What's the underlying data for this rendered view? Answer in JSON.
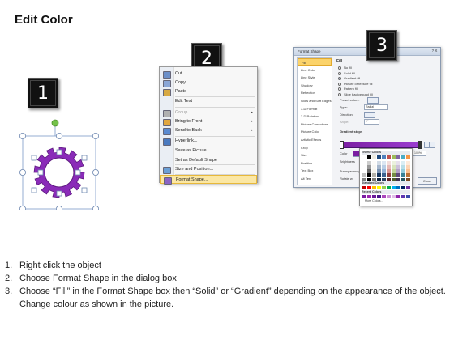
{
  "header": {
    "title": "Edit Color"
  },
  "badges": [
    "1",
    "2",
    "3"
  ],
  "context_menu": {
    "items": [
      {
        "label": "Cut",
        "icon": "scissors-icon",
        "enabled": true,
        "submenu": false
      },
      {
        "label": "Copy",
        "icon": "copy-icon",
        "enabled": true,
        "submenu": false
      },
      {
        "label": "Paste",
        "icon": "paste-icon",
        "enabled": true,
        "submenu": false
      },
      {
        "label": "Edit Text",
        "icon": "",
        "enabled": true,
        "submenu": false
      },
      {
        "label": "Group",
        "icon": "group-icon",
        "enabled": false,
        "submenu": true
      },
      {
        "label": "Bring to Front",
        "icon": "bring-to-front-icon",
        "enabled": true,
        "submenu": true
      },
      {
        "label": "Send to Back",
        "icon": "send-to-back-icon",
        "enabled": true,
        "submenu": true
      },
      {
        "label": "Hyperlink...",
        "icon": "hyperlink-icon",
        "enabled": true,
        "submenu": false
      },
      {
        "label": "Save as Picture...",
        "icon": "",
        "enabled": true,
        "submenu": false
      },
      {
        "label": "Set as Default Shape",
        "icon": "",
        "enabled": true,
        "submenu": false
      },
      {
        "label": "Size and Position...",
        "icon": "size-icon",
        "enabled": true,
        "submenu": false
      },
      {
        "label": "Format Shape...",
        "icon": "format-shape-icon",
        "enabled": true,
        "submenu": false,
        "selected": true
      }
    ]
  },
  "dialog": {
    "title": "Format Shape",
    "close": "?  X",
    "sidebar": [
      "Fill",
      "Line Color",
      "Line Style",
      "Shadow",
      "Reflection",
      "Glow and Soft Edges",
      "3-D Format",
      "3-D Rotation",
      "Picture Corrections",
      "Picture Color",
      "Artistic Effects",
      "Crop",
      "Size",
      "Position",
      "Text Box",
      "Alt Text"
    ],
    "fill_heading": "Fill",
    "fill_options": [
      {
        "label": "No fill",
        "on": false
      },
      {
        "label": "Solid fill",
        "on": false
      },
      {
        "label": "Gradient fill",
        "on": true
      },
      {
        "label": "Picture or texture fill",
        "on": false
      },
      {
        "label": "Pattern fill",
        "on": false
      },
      {
        "label": "Slide background fill",
        "on": false
      }
    ],
    "preset_label": "Preset colors:",
    "type_label": "Type:",
    "type_value": "Radial",
    "direction_label": "Direction:",
    "angle_label": "Angle:",
    "angle_value": "0°",
    "stops_label": "Gradient stops",
    "color_label": "Color",
    "position_label": "Position:",
    "position_value": "100%",
    "brightness_label": "Brightness",
    "transparency_label": "Transparency",
    "rotate_label": "Rotate w",
    "close_button": "Close"
  },
  "palette": {
    "theme_label": "Theme Colors",
    "standard_label": "Standard Colors",
    "recent_label": "Recent Colors",
    "more_label": "More Colors...",
    "theme_top": [
      "#ffffff",
      "#000000",
      "#eeece1",
      "#1f497d",
      "#4f81bd",
      "#c0504d",
      "#9bbb59",
      "#8064a2",
      "#4bacc6",
      "#f79646"
    ],
    "standard": [
      "#c00000",
      "#ff0000",
      "#ffc000",
      "#ffff00",
      "#92d050",
      "#00b050",
      "#00b0f0",
      "#0070c0",
      "#002060",
      "#7030a0"
    ],
    "recent": [
      "#7b1fa2",
      "#9c27b0",
      "#6a1b9a",
      "#4a148c",
      "#ab47bc",
      "#ce93d8",
      "#e1bee7",
      "#8e24aa",
      "#5e35b1",
      "#3949ab"
    ],
    "accent": "#8e24aa"
  },
  "gear": {
    "color": "#8a2bb8",
    "dark": "#5d1a80"
  },
  "steps": [
    {
      "num": "1.",
      "text": "Right click the object"
    },
    {
      "num": "2.",
      "text": "Choose Format Shape in the dialog box"
    },
    {
      "num": "3.",
      "text": "Choose “Fill” in the Format Shape box then “Solid” or “Gradient” depending on the appearance of the object. Change colour as shown in the picture."
    }
  ]
}
